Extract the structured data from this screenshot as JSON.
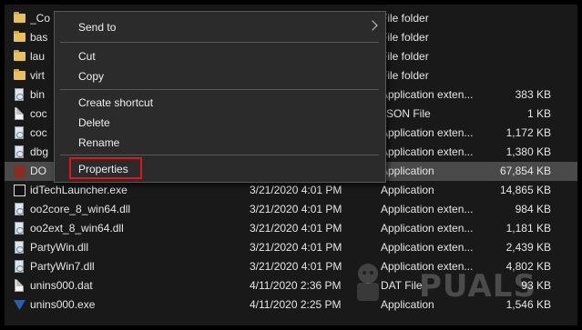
{
  "files": [
    {
      "name": "_Co",
      "date": "",
      "type": "File folder",
      "size": "",
      "icon": "folder-icon"
    },
    {
      "name": "bas",
      "date": "",
      "type": "File folder",
      "size": "",
      "icon": "folder-icon"
    },
    {
      "name": "lau",
      "date": "",
      "type": "File folder",
      "size": "",
      "icon": "folder-icon"
    },
    {
      "name": "virt",
      "date": "",
      "type": "File folder",
      "size": "",
      "icon": "folder-icon"
    },
    {
      "name": "bin",
      "date": "",
      "type": "Application exten...",
      "size": "383 KB",
      "icon": "dll-icon"
    },
    {
      "name": "coc",
      "date": "",
      "type": "JSON File",
      "size": "1 KB",
      "icon": "file-icon"
    },
    {
      "name": "coc",
      "date": "",
      "type": "Application exten...",
      "size": "1,172 KB",
      "icon": "dll-icon"
    },
    {
      "name": "dbg",
      "date": "",
      "type": "Application exten...",
      "size": "1,380 KB",
      "icon": "dll-icon"
    },
    {
      "name": "DO",
      "date": "",
      "type": "Application",
      "size": "67,854 KB",
      "icon": "doom-icon",
      "selected": true
    },
    {
      "name": "idTechLauncher.exe",
      "date": "3/21/2020 4:01 PM",
      "type": "Application",
      "size": "14,865 KB",
      "icon": "idtech-icon"
    },
    {
      "name": "oo2core_8_win64.dll",
      "date": "3/21/2020 4:01 PM",
      "type": "Application exten...",
      "size": "984 KB",
      "icon": "dll-icon"
    },
    {
      "name": "oo2ext_8_win64.dll",
      "date": "3/21/2020 4:01 PM",
      "type": "Application exten...",
      "size": "1,181 KB",
      "icon": "dll-icon"
    },
    {
      "name": "PartyWin.dll",
      "date": "3/21/2020 4:01 PM",
      "type": "Application exten...",
      "size": "2,439 KB",
      "icon": "dll-icon"
    },
    {
      "name": "PartyWin7.dll",
      "date": "3/21/2020 4:01 PM",
      "type": "Application exten...",
      "size": "4,802 KB",
      "icon": "dll-icon"
    },
    {
      "name": "unins000.dat",
      "date": "4/11/2020 2:36 PM",
      "type": "DAT File",
      "size": "93 KB",
      "icon": "file-icon"
    },
    {
      "name": "unins000.exe",
      "date": "4/11/2020 2:25 PM",
      "type": "Application",
      "size": "1,546 KB",
      "icon": "uninstall-icon"
    }
  ],
  "context_menu": {
    "send_to": "Send to",
    "cut": "Cut",
    "copy": "Copy",
    "create_shortcut": "Create shortcut",
    "delete": "Delete",
    "rename": "Rename",
    "properties": "Properties"
  },
  "watermark": "PUALS",
  "colors": {
    "background": "#191919",
    "selection": "#4a4a4a",
    "menu": "#2b2b2b",
    "highlight_box": "#e3151a",
    "folder": "#e8c15c"
  }
}
